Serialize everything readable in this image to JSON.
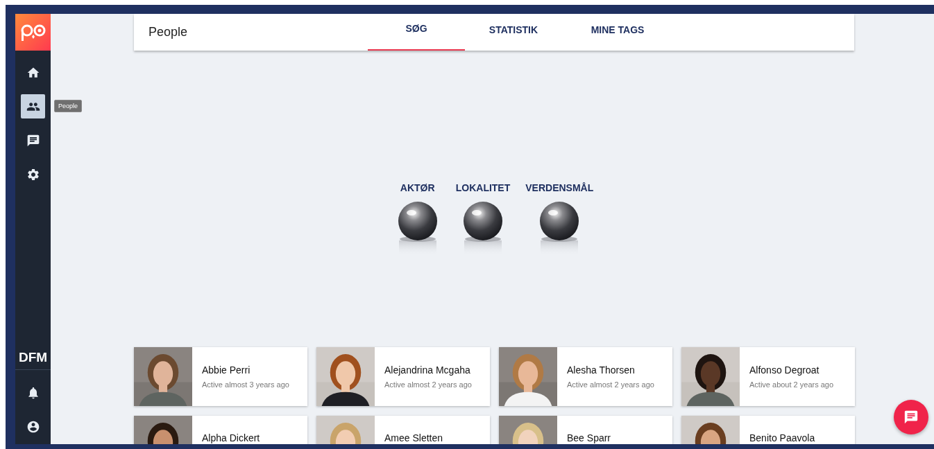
{
  "sidebar": {
    "top_items": [
      {
        "kind": "home",
        "selected": false
      },
      {
        "kind": "people",
        "selected": true
      },
      {
        "kind": "chat",
        "selected": false
      },
      {
        "kind": "settings",
        "selected": false
      }
    ],
    "tooltip": "People",
    "org": "DFM",
    "bottom_items": [
      {
        "kind": "bell",
        "selected": false
      },
      {
        "kind": "account",
        "selected": false
      }
    ]
  },
  "header": {
    "title": "People",
    "tabs": [
      {
        "label": "SØG",
        "selected": true
      },
      {
        "label": "STATISTIK",
        "selected": false
      },
      {
        "label": "MINE TAGS",
        "selected": false
      }
    ]
  },
  "categories": [
    {
      "label": "AKTØR"
    },
    {
      "label": "LOKALITET"
    },
    {
      "label": "VERDENSMÅL"
    }
  ],
  "people": [
    {
      "name": "Abbie Perri",
      "activity": "Active almost 3 years ago"
    },
    {
      "name": "Alejandrina Mcgaha",
      "activity": "Active almost 2 years ago"
    },
    {
      "name": "Alesha Thorsen",
      "activity": "Active almost 2 years ago"
    },
    {
      "name": "Alfonso Degroat",
      "activity": "Active about 2 years ago"
    },
    {
      "name": "Alpha Dickert"
    },
    {
      "name": "Amee Sletten"
    },
    {
      "name": "Bee Sparr"
    },
    {
      "name": "Benito Paavola"
    }
  ]
}
